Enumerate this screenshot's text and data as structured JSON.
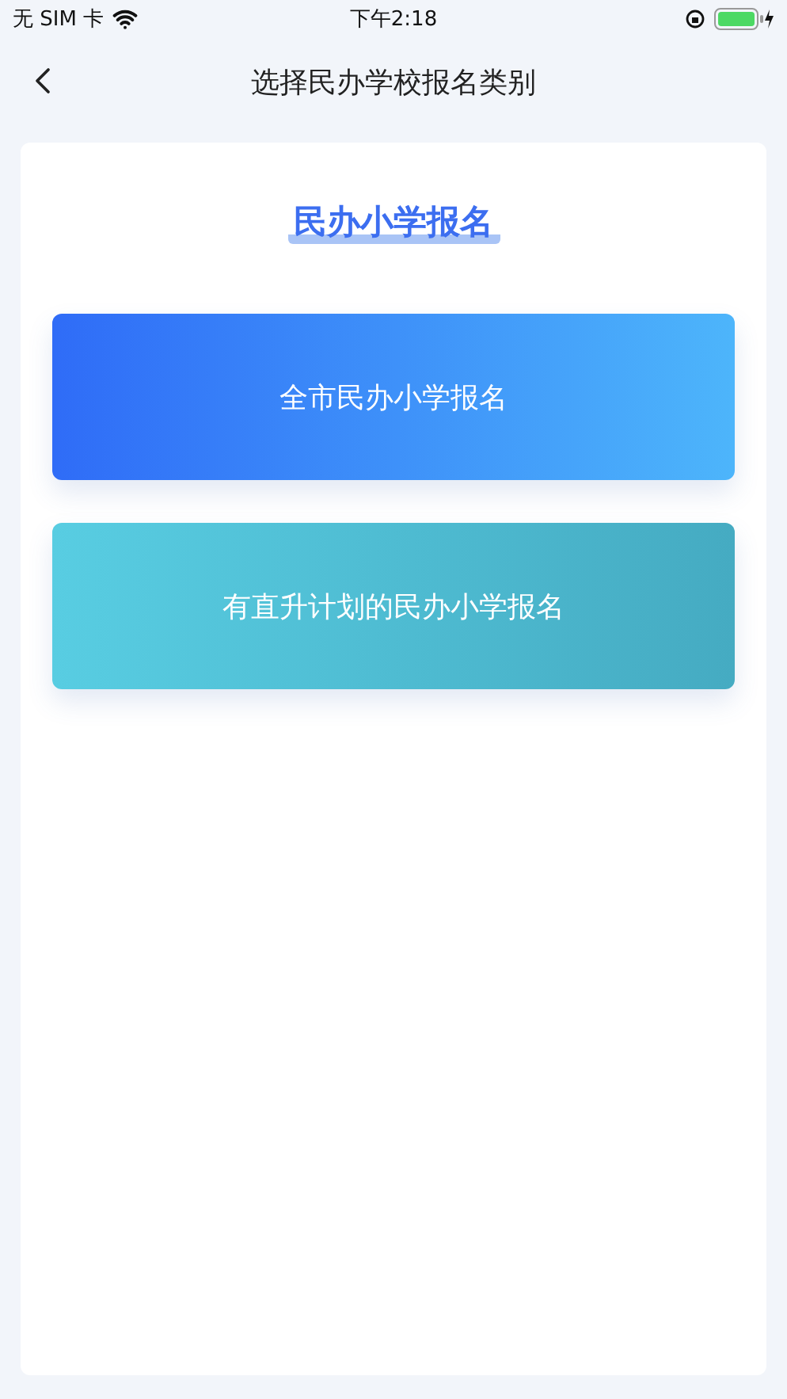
{
  "status_bar": {
    "carrier": "无 SIM 卡",
    "time": "下午2:18"
  },
  "nav": {
    "title": "选择民办学校报名类别"
  },
  "section": {
    "heading": "民办小学报名"
  },
  "options": [
    {
      "label": "全市民办小学报名",
      "kind": "primary"
    },
    {
      "label": "有直升计划的民办小学报名",
      "kind": "secondary"
    }
  ]
}
